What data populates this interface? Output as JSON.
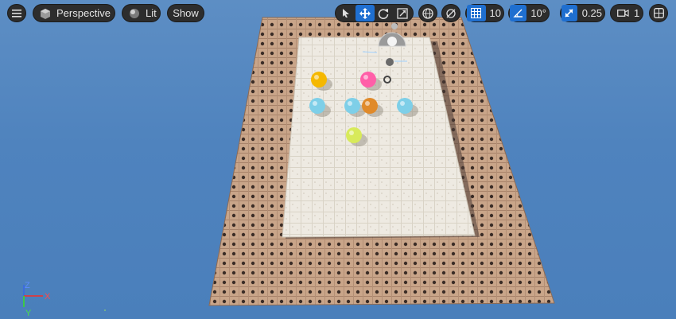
{
  "toolbar": {
    "menu_icon": "hamburger-icon",
    "perspective_label": "Perspective",
    "lit_label": "Lit",
    "show_label": "Show",
    "grid_snap_value": "10",
    "rotation_snap_value": "10°",
    "scale_snap_value": "0.25",
    "camera_speed_value": "1"
  },
  "axis_gizmo": {
    "z_label": "Z",
    "x_label": "X",
    "y_label": "Y"
  },
  "colors": {
    "sky": "#4f83be",
    "toolbar_bg": "#2d2d2d",
    "active_blue": "#1f6fd0",
    "wood_tile": "#c9a589",
    "snow_tile": "#eeeae2",
    "axis_x": "#e03a3a",
    "axis_y": "#3ad03a",
    "axis_z": "#3a6ae0"
  },
  "scene_objects": [
    {
      "name": "yellow-candy",
      "color": "#f5b800"
    },
    {
      "name": "pink-candy",
      "color": "#ff5fa8"
    },
    {
      "name": "blue-candy-1",
      "color": "#7ecfe8"
    },
    {
      "name": "blue-candy-2",
      "color": "#7ecfe8"
    },
    {
      "name": "blue-candy-3",
      "color": "#7ecfe8"
    },
    {
      "name": "orange-candy-basket",
      "color": "#e08a2a"
    },
    {
      "name": "yellow-green-candy",
      "color": "#d8ea5a"
    }
  ]
}
